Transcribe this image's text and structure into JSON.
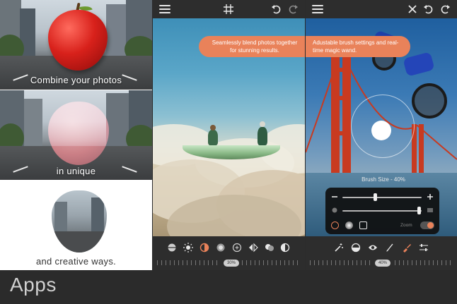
{
  "panel1": {
    "captions": [
      "Combine your photos",
      "in unique",
      "and creative ways."
    ]
  },
  "panel2": {
    "tooltip": "Seamlessly blend photos together for stunning results.",
    "tools": [
      "layer-icon",
      "brightness-icon",
      "contrast-icon",
      "saturation-icon",
      "exposure-icon",
      "flip-icon",
      "blend-icon",
      "invert-icon"
    ],
    "ruler_value": "30%"
  },
  "panel3": {
    "tooltip": "Adustable brush settings and real-time magic wand.",
    "brush_size_label": "Brush Size - 40%",
    "zoom_label": "Zoom",
    "tools": [
      "magic-wand-icon",
      "eraser-icon",
      "eye-icon",
      "brush-icon",
      "paint-brush-icon",
      "sliders-icon"
    ],
    "ruler_value": "40%",
    "accent": "#e9825a"
  },
  "footer": {
    "label": "Apps"
  }
}
